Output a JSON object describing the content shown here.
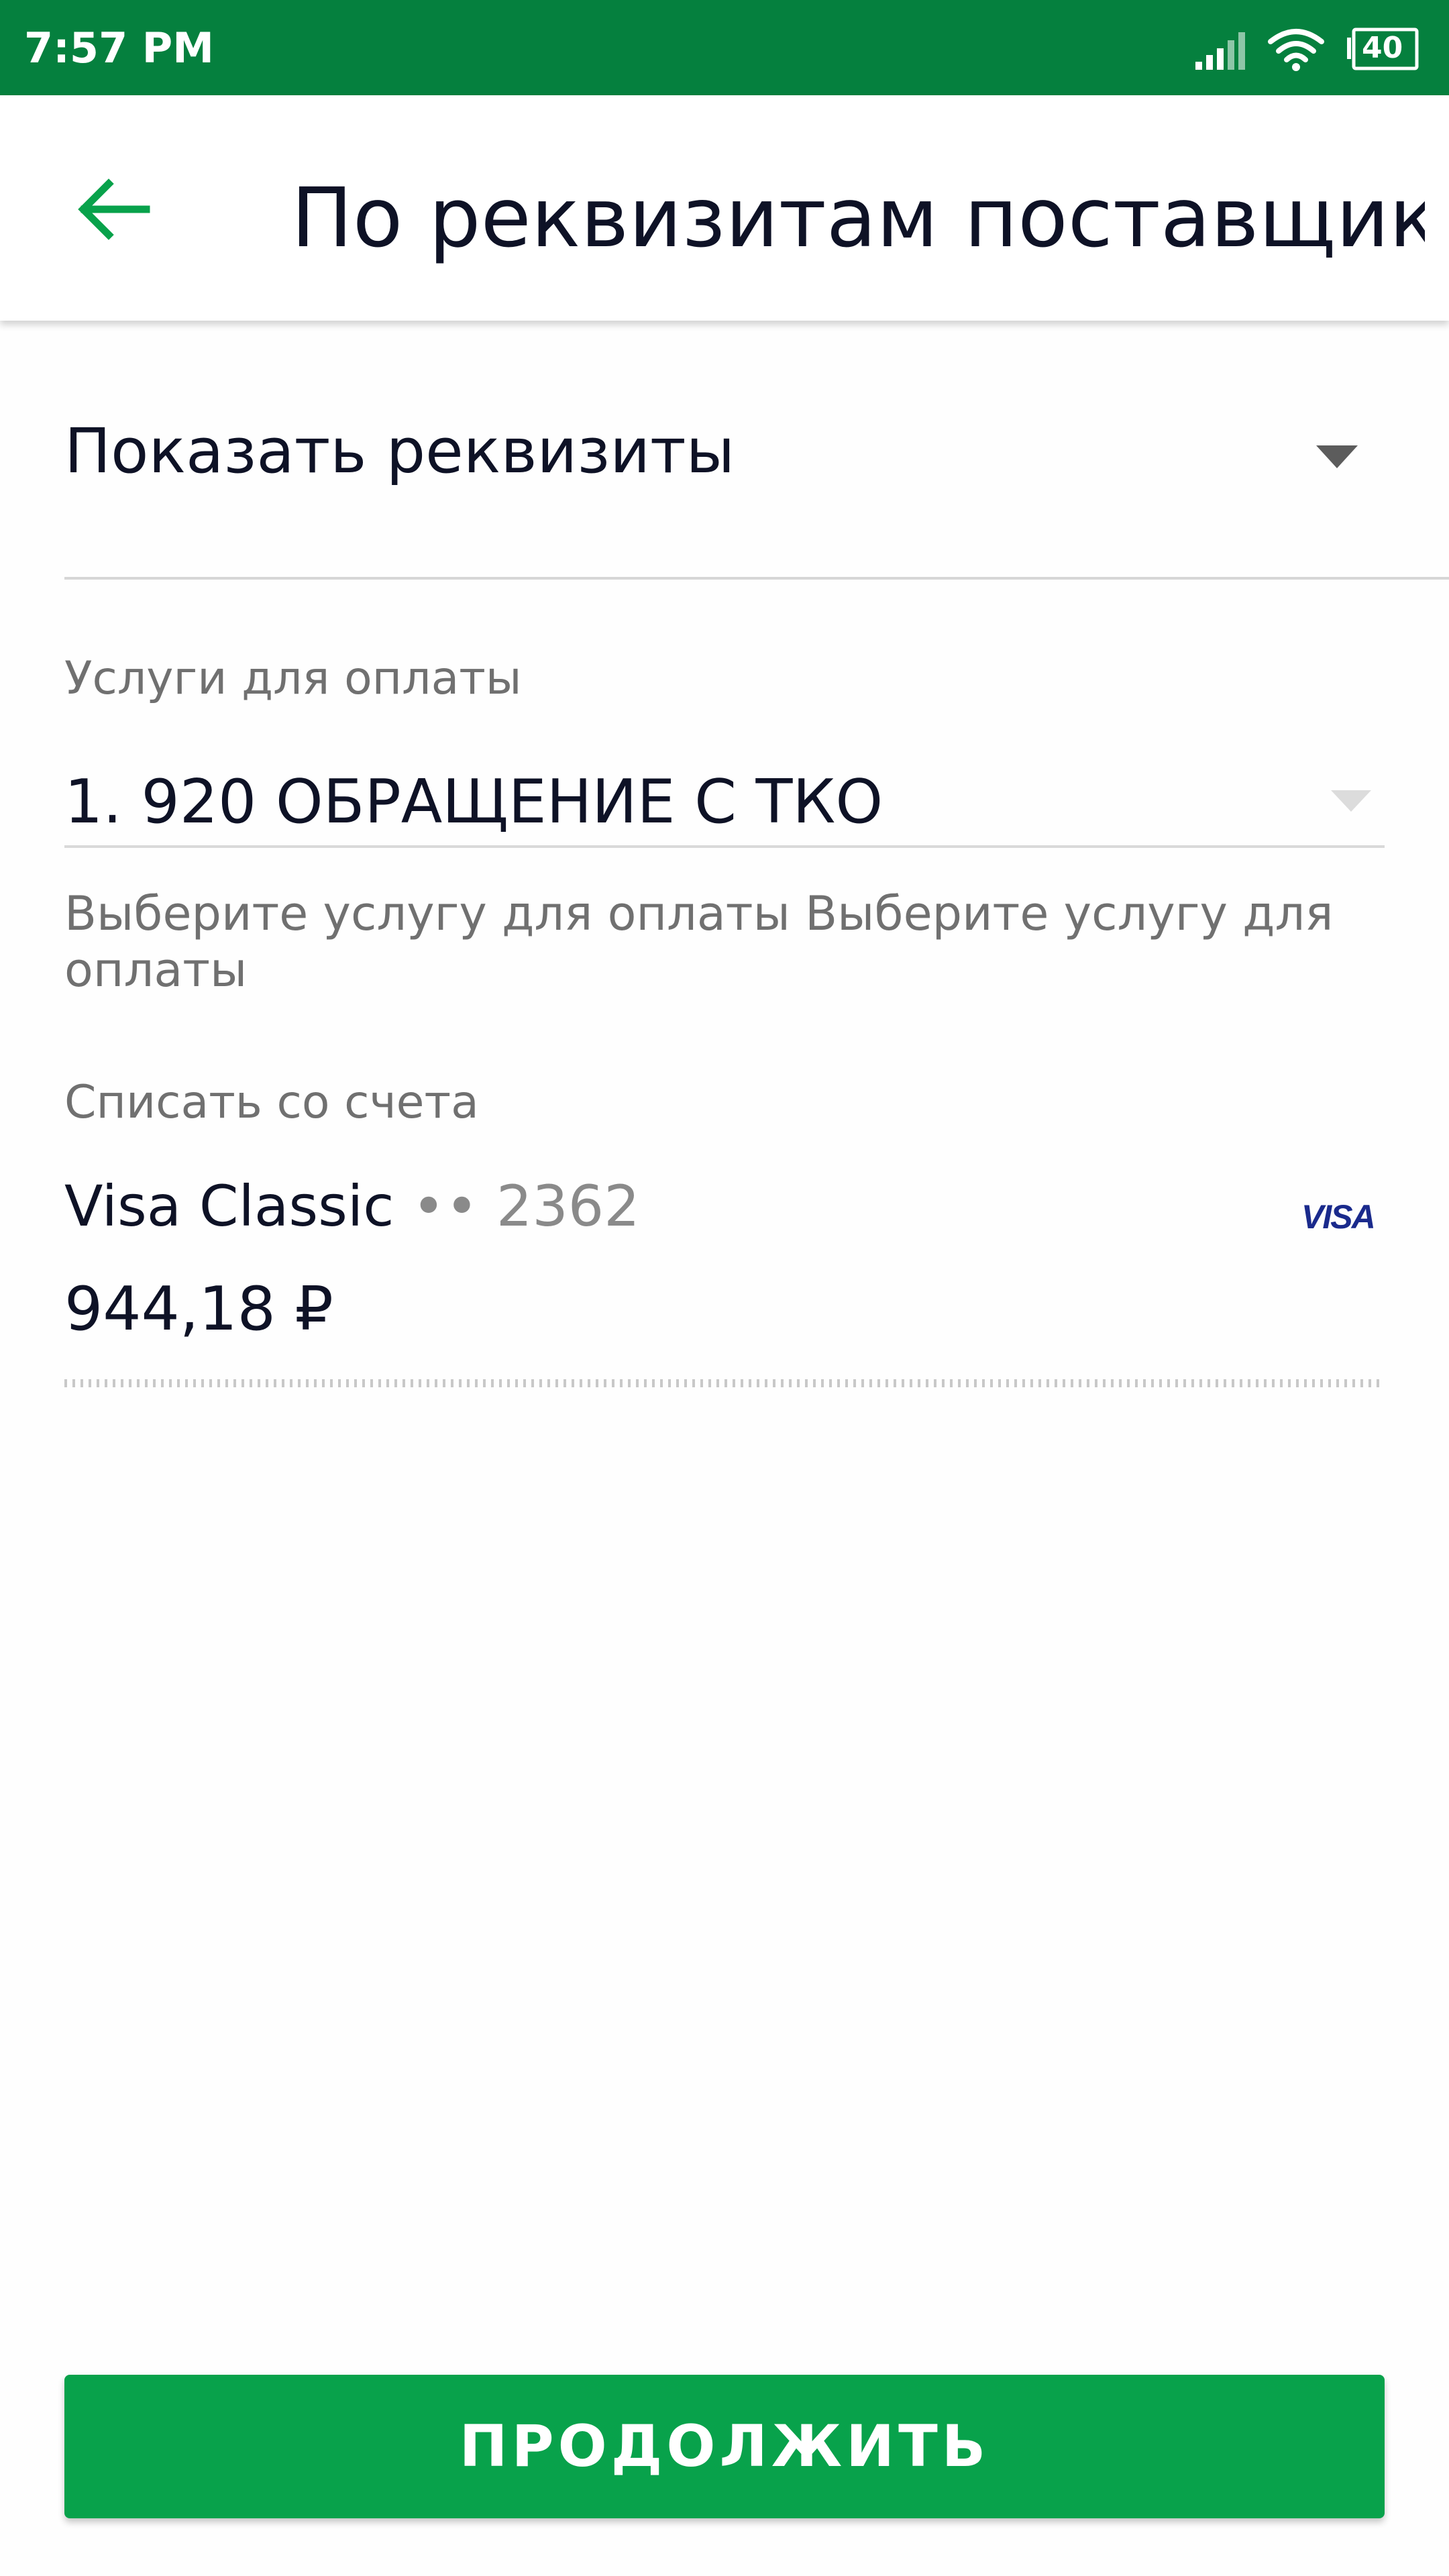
{
  "status_bar": {
    "time": "7:57 PM",
    "battery": "40",
    "icons": [
      "signal-icon",
      "wifi-icon",
      "battery-icon"
    ]
  },
  "app_bar": {
    "title": "По реквизитам поставщика...",
    "back_icon": "arrow-left-icon"
  },
  "details": {
    "label": "Показать реквизиты",
    "icon": "chevron-down-icon"
  },
  "service": {
    "label": "Услуги для оплаты",
    "value": "1. 920 ОБРАЩЕНИЕ С ТКО",
    "helper": "Выберите услугу для оплаты Выберите услугу для оплаты"
  },
  "account": {
    "label": "Списать со счета",
    "card_name": "Visa Classic",
    "card_mask": "••",
    "card_number": "2362",
    "payment_system": "VISA",
    "balance": "944,18 ₽"
  },
  "actions": {
    "continue_label": "ПРОДОЛЖИТЬ"
  },
  "colors": {
    "status_bar": "#05803e",
    "accent": "#08a24b",
    "text_primary": "#0e1226",
    "text_secondary": "#707070",
    "visa": "#1a2a8c"
  }
}
